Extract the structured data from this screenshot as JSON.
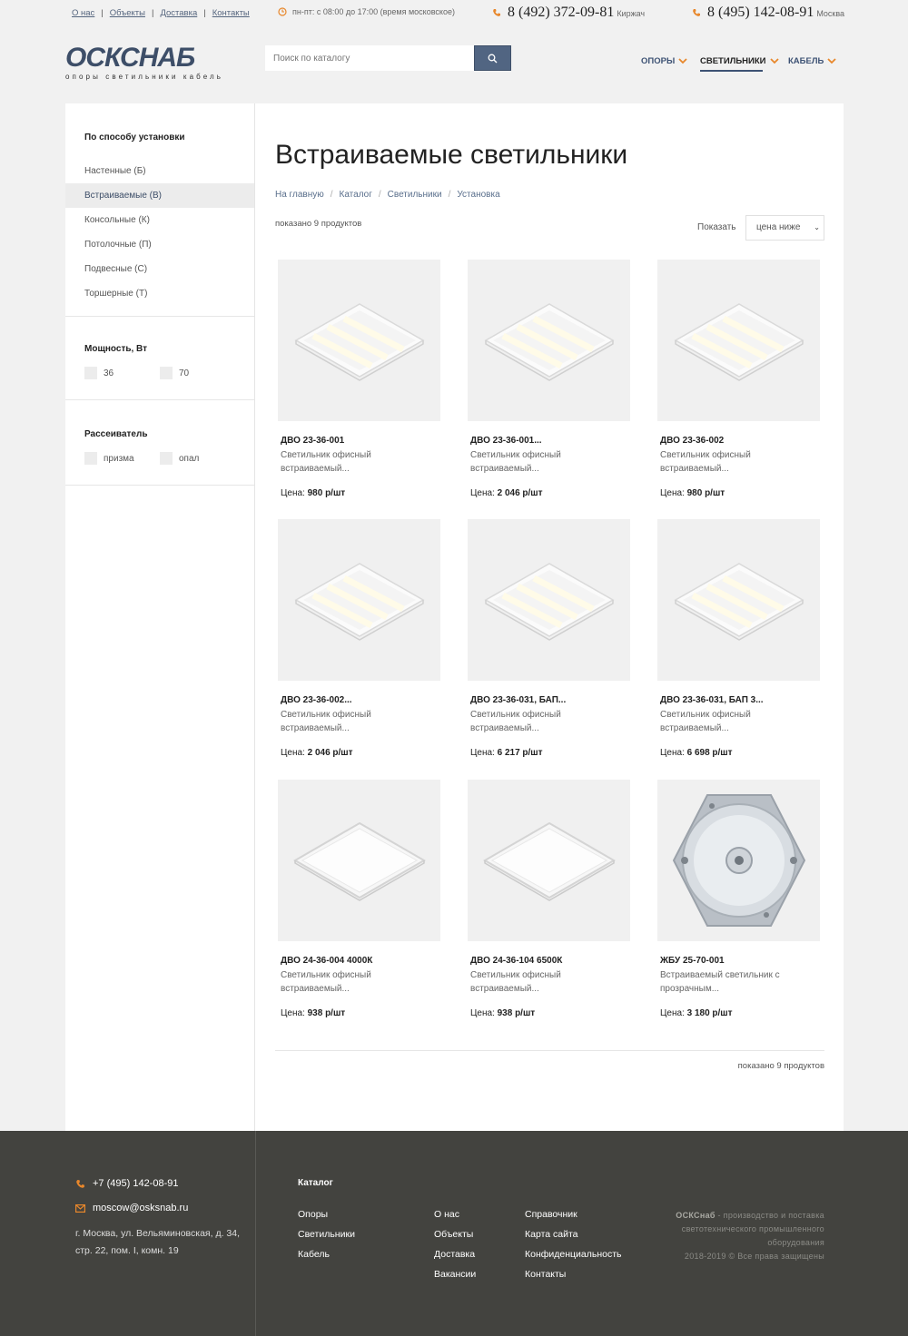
{
  "topbar": {
    "links": [
      "О нас",
      "Объекты",
      "Доставка",
      "Контакты"
    ],
    "separator": "|",
    "hours": "пн-пт: с 08:00 до 17:00 (время московское)",
    "phones": [
      {
        "number": "8 (492) 372-09-81",
        "city": "Киржач"
      },
      {
        "number": "8 (495) 142-08-91",
        "city": "Москва"
      }
    ]
  },
  "header": {
    "logo_text": "ОСКСНАБ",
    "logo_sub": "опоры светильники кабель",
    "search_placeholder": "Поиск по каталогу",
    "nav": [
      {
        "label": "ОПОРЫ"
      },
      {
        "label": "СВЕТИЛЬНИКИ"
      },
      {
        "label": "КАБЕЛЬ"
      }
    ],
    "accent_color": "#e8872b",
    "brand_color": "#3d5274"
  },
  "sidebar": {
    "install_title": "По способу установки",
    "install_items": [
      "Настенные (Б)",
      "Встраиваемые (В)",
      "Консольные (К)",
      "Потолочные (П)",
      "Подвесные (С)",
      "Торшерные (Т)"
    ],
    "power_title": "Мощность, Вт",
    "power_options": [
      "36",
      "70"
    ],
    "diffuser_title": "Рассеиватель",
    "diffuser_options": [
      "призма",
      "опал"
    ]
  },
  "content": {
    "title": "Встраиваемые светильники",
    "breadcrumb": [
      "На главную",
      "Каталог",
      "Светильники",
      "Установка"
    ],
    "breadcrumb_sep": "/",
    "count_text": "показано 9 продуктов",
    "sort_label": "Показать",
    "sort_value": "цена ниже",
    "price_label": "Цена:",
    "products": [
      {
        "name": "ДВО 23-36-001",
        "desc": "Светильник офисный встраиваемый...",
        "price": "980 р/шт",
        "image": "panel-prism"
      },
      {
        "name": "ДВО 23-36-001...",
        "desc": "Светильник офисный встраиваемый...",
        "price": "2 046 р/шт",
        "image": "panel-prism"
      },
      {
        "name": "ДВО 23-36-002",
        "desc": "Светильник офисный встраиваемый...",
        "price": "980 р/шт",
        "image": "panel-prism"
      },
      {
        "name": "ДВО 23-36-002...",
        "desc": "Светильник офисный встраиваемый...",
        "price": "2 046 р/шт",
        "image": "panel-prism"
      },
      {
        "name": "ДВО 23-36-031, БАП...",
        "desc": "Светильник офисный встраиваемый...",
        "price": "6 217 р/шт",
        "image": "panel-prism"
      },
      {
        "name": "ДВО 23-36-031, БАП 3...",
        "desc": "Светильник офисный встраиваемый...",
        "price": "6 698 р/шт",
        "image": "panel-prism"
      },
      {
        "name": "ДВО 24-36-004 4000К",
        "desc": "Светильник офисный встраиваемый...",
        "price": "938 р/шт",
        "image": "panel-opal"
      },
      {
        "name": "ДВО 24-36-104 6500К",
        "desc": "Светильник офисный встраиваемый...",
        "price": "938 р/шт",
        "image": "panel-opal"
      },
      {
        "name": "ЖБУ 25-70-001",
        "desc": "Встраиваемый светильник с прозрачным...",
        "price": "3 180 р/шт",
        "image": "hex-lamp"
      }
    ]
  },
  "footer": {
    "phone": "+7 (495) 142-08-91",
    "email": "moscow@osksnab.ru",
    "address": "г. Москва, ул. Вельяминовская, д. 34, стр. 22, пом. I, комн. 19",
    "catalog_title": "Каталог",
    "col1": [
      "Опоры",
      "Светильники",
      "Кабель"
    ],
    "col2": [
      "О нас",
      "Объекты",
      "Доставка",
      "Вакансии"
    ],
    "col3": [
      "Справочник",
      "Карта сайта",
      "Конфиденциальность",
      "Контакты"
    ],
    "about_brand": "ОСКСнаб",
    "about_text": " - производство и поставка светотехнического промышленного оборудования",
    "copyright": "2018-2019 © Все права защищены"
  }
}
